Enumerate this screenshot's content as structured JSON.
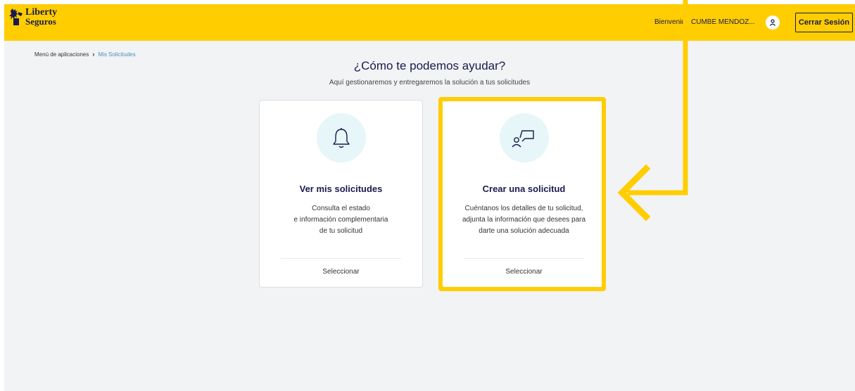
{
  "header": {
    "logo_line1": "Liberty",
    "logo_line2": "Seguros",
    "welcome": "Bienvenid",
    "username": "CUMBE MENDOZ...",
    "logout_label": "Cerrar Sesión"
  },
  "breadcrumb": {
    "root": "Menú de aplicaciones",
    "current": "Mis Solicitudes"
  },
  "main": {
    "title": "¿Cómo te podemos ayudar?",
    "subtitle": "Aquí gestionaremos y entregaremos la solución a tus solicitudes"
  },
  "cards": [
    {
      "icon": "bell-icon",
      "title": "Ver mis solicitudes",
      "desc_lines": [
        "Consulta el estado",
        "e información complementaria",
        "de tu solicitud"
      ],
      "action": "Seleccionar"
    },
    {
      "icon": "person-chat-icon",
      "title": "Crear una solicitud",
      "desc_lines": [
        "Cuéntanos los detalles de tu solicitud,",
        "adjunta la información que desees para",
        "darte una solución adecuada"
      ],
      "action": "Seleccionar"
    }
  ],
  "colors": {
    "brand_yellow": "#FFCD00",
    "navy": "#1a1a4e",
    "icon_bg": "#e6f6f9"
  }
}
